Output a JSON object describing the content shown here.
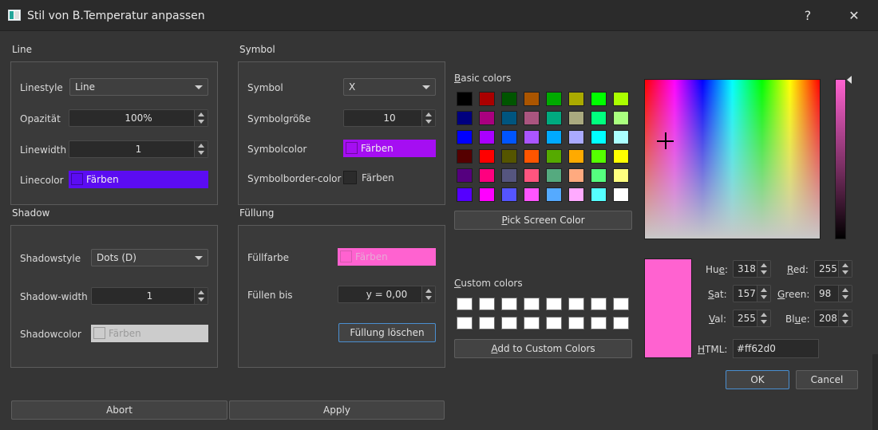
{
  "window": {
    "title": "Stil von B.Temperatur anpassen",
    "help": "?",
    "close": "✕"
  },
  "line": {
    "group": "Line",
    "linestyle_label": "Linestyle",
    "linestyle_value": "Line",
    "opacity_label": "Opazität",
    "opacity_value": "100%",
    "linewidth_label": "Linewidth",
    "linewidth_value": "1",
    "linecolor_label": "Linecolor",
    "linecolor_button": "Färben",
    "linecolor": "#5b0cf2"
  },
  "symbol": {
    "group": "Symbol",
    "symbol_label": "Symbol",
    "symbol_value": "X",
    "size_label": "Symbolgröße",
    "size_value": "10",
    "color_label": "Symbolcolor",
    "color_button": "Färben",
    "color": "#a50ef2",
    "border_label": "Symbolborder-color",
    "border_button": "Färben",
    "border_color": "#2b2b2b"
  },
  "shadow": {
    "group": "Shadow",
    "style_label": "Shadowstyle",
    "style_value": "Dots (D)",
    "width_label": "Shadow-width",
    "width_value": "1",
    "color_label": "Shadowcolor",
    "color_button": "Färben",
    "color": "#cccccc"
  },
  "fill": {
    "group": "Füllung",
    "color_label": "Füllfarbe",
    "color_button": "Färben",
    "color": "#ff62d0",
    "until_label": "Füllen bis",
    "until_value": "y = 0,00",
    "clear_button": "Füllung löschen"
  },
  "dialog_buttons": {
    "abort": "Abort",
    "apply": "Apply",
    "ok": "OK",
    "cancel": "Cancel"
  },
  "color_picker": {
    "basic_label_prefix": "B",
    "basic_label_rest": "asic colors",
    "basic_colors": [
      [
        "#000000",
        "#aa0000",
        "#005500",
        "#aa5500",
        "#00aa00",
        "#aaaa00",
        "#00ff00",
        "#aaff00"
      ],
      [
        "#00007f",
        "#aa007f",
        "#00557f",
        "#aa557f",
        "#00aa7f",
        "#aaaa7f",
        "#00ff7f",
        "#aaff7f"
      ],
      [
        "#0000ff",
        "#aa00ff",
        "#0055ff",
        "#aa55ff",
        "#00aaff",
        "#aaaaff",
        "#00ffff",
        "#aaffff"
      ],
      [
        "#550000",
        "#ff0000",
        "#555500",
        "#ff5500",
        "#55aa00",
        "#ffaa00",
        "#55ff00",
        "#ffff00"
      ],
      [
        "#55007f",
        "#ff007f",
        "#55557f",
        "#ff557f",
        "#55aa7f",
        "#ffaa7f",
        "#55ff7f",
        "#ffff7f"
      ],
      [
        "#5500ff",
        "#ff00ff",
        "#5555ff",
        "#ff55ff",
        "#55aaff",
        "#ffaaff",
        "#55ffff",
        "#ffffff"
      ]
    ],
    "pick_screen_prefix": "P",
    "pick_screen_rest": "ick Screen Color",
    "custom_label_prefix": "C",
    "custom_label_rest": "ustom colors",
    "custom_colors": [
      [
        "#ffffff",
        "#ffffff",
        "#ffffff",
        "#ffffff",
        "#ffffff",
        "#ffffff",
        "#ffffff",
        "#ffffff"
      ],
      [
        "#ffffff",
        "#ffffff",
        "#ffffff",
        "#ffffff",
        "#ffffff",
        "#ffffff",
        "#ffffff",
        "#ffffff"
      ]
    ],
    "add_custom_prefix": "A",
    "add_custom_rest": "dd to Custom Colors",
    "current_color": "#ff62d0",
    "hue_label_a": "Hu",
    "hue_label_u": "e",
    "hue_label_colon": ":",
    "hue_value": "318",
    "sat_label_u": "S",
    "sat_label_b": "at:",
    "sat_value": "157",
    "val_label_u": "V",
    "val_label_b": "al:",
    "val_value": "255",
    "red_label_u": "R",
    "red_label_b": "ed:",
    "red_value": "255",
    "green_label_u": "G",
    "green_label_b": "reen:",
    "green_value": "98",
    "blue_label_a": "Bl",
    "blue_label_u": "u",
    "blue_label_b": "e:",
    "blue_value": "208",
    "html_label_u": "H",
    "html_label_b": "TML:",
    "html_value": "#ff62d0"
  }
}
